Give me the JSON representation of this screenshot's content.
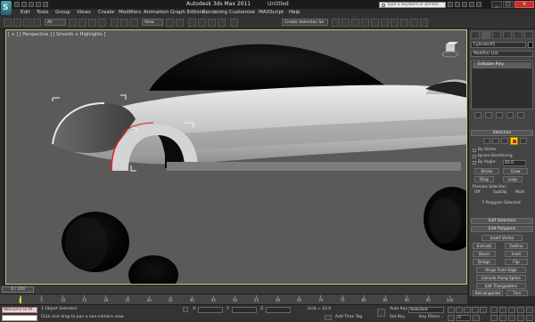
{
  "app": {
    "title": "Autodesk 3ds Max 2011",
    "title_file": "Untitled",
    "search_placeholder": "Type a keyword or phrase",
    "window_buttons": [
      "_",
      "□",
      "✕"
    ]
  },
  "menu": [
    "Edit",
    "Tools",
    "Group",
    "Views",
    "Create",
    "Modifiers",
    "Animation",
    "Graph Editors",
    "Rendering",
    "Customize",
    "MAXScript",
    "Help"
  ],
  "toolbar": {
    "filter": "All",
    "ref_coord": "View",
    "selection_set": "Create Selection Se"
  },
  "viewport": {
    "label": "[ + ] [ Perspective ] [ Smooth + Highlights ]"
  },
  "command_panel": {
    "object_name": "Cylinder01",
    "modifier_list": "Modifier List",
    "stack_item": "Editable Poly",
    "selection": {
      "title": "Selection",
      "by_vertex": "By Vertex",
      "ignore_backfacing": "Ignore Backfacing",
      "by_angle": "By Angle:",
      "angle_value": "45.0",
      "shrink": "Shrink",
      "grow": "Grow",
      "ring": "Ring",
      "loop": "Loop",
      "preview_selection": "Preview Selection",
      "preview_options": [
        "Off",
        "SubObj",
        "Multi"
      ],
      "status": "7 Polygons Selected"
    },
    "soft_selection": "Soft Selection",
    "edit_polygons": {
      "title": "Edit Polygons",
      "insert_vertex": "Insert Vertex",
      "extrude": "Extrude",
      "outline": "Outline",
      "bevel": "Bevel",
      "inset": "Inset",
      "bridge": "Bridge",
      "flip": "Flip",
      "hinge": "Hinge From Edge",
      "extrude_spline": "Extrude Along Spline",
      "edit_triangulation": "Edit Triangulation",
      "retriangulate": "Retriangulate",
      "turn": "Turn"
    }
  },
  "timeline": {
    "frame": "0 / 100",
    "ticks": [
      "0",
      "5",
      "10",
      "15",
      "20",
      "25",
      "30",
      "35",
      "40",
      "45",
      "50",
      "55",
      "60",
      "65",
      "70",
      "75",
      "80",
      "85",
      "90",
      "95",
      "100"
    ]
  },
  "status": {
    "maxscript": "Welcome to M",
    "selected": "1 Object Selected",
    "prompt": "Click and drag to pan a non-camera view",
    "x_label": "X:",
    "y_label": "Y:",
    "z_label": "Z:",
    "grid": "Grid = 10.0",
    "add_time_tag": "Add Time Tag",
    "auto_key": "Auto Key",
    "selected_dropdown": "Selected",
    "set_key": "Set Key",
    "key_filters": "Key Filters...",
    "frame_value": "0"
  },
  "colors": {
    "viewport_bg": "#5a5a5a",
    "selection_red": "#e02020",
    "panel_bg": "#444444",
    "active_yellow": "#f2d400"
  }
}
